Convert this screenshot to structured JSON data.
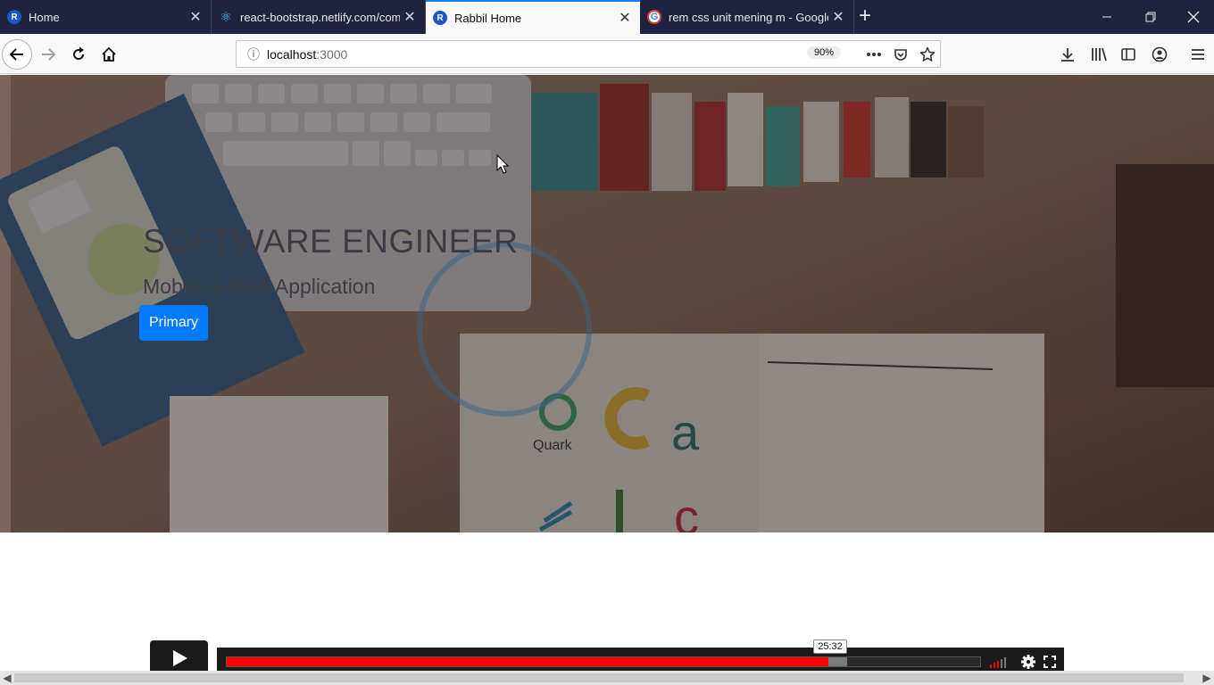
{
  "browser": {
    "tabs": [
      {
        "title": "Home",
        "favicon": "rabbil-favicon-icon",
        "active": false
      },
      {
        "title": "react-bootstrap.netlify.com/components",
        "favicon": "react-bootstrap-favicon-icon",
        "active": false
      },
      {
        "title": "Rabbil Home",
        "favicon": "rabbil-favicon-icon",
        "active": true
      },
      {
        "title": "rem css unit mening m - Google Search",
        "favicon": "google-favicon-icon",
        "active": false
      }
    ],
    "new_tab_label": "+",
    "url": {
      "host": "localhost",
      "port": ":3000"
    },
    "zoom": "90%",
    "accent_color": "#0a84ff"
  },
  "page": {
    "hero": {
      "title": "SOFTWARE ENGINEER",
      "subtitle": "Mobile & Web Application",
      "button_label": "Primary",
      "button_color": "#007bff"
    }
  },
  "video_player": {
    "time_tooltip": "25:32",
    "progress_played": 0.799,
    "progress_buffered": 0.823,
    "played_color": "#ff0000"
  }
}
